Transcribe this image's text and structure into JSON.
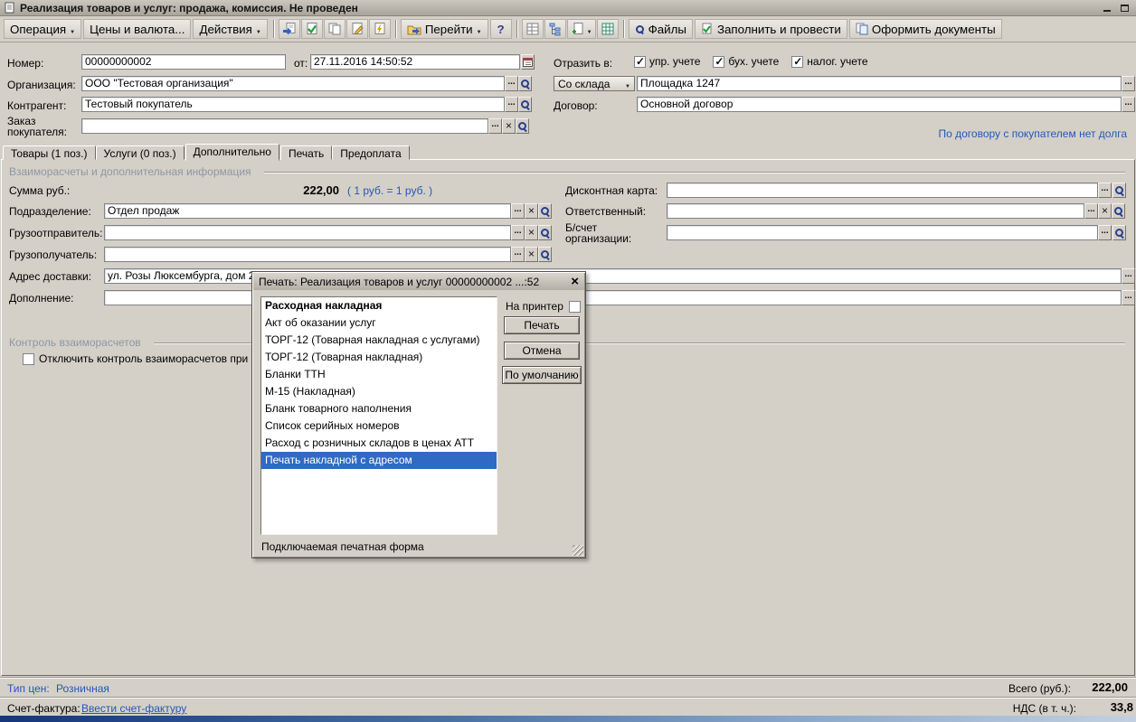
{
  "colors": {
    "link": "#2457b8",
    "selection": "#316ac5",
    "window_bg": "#d4d0c8"
  },
  "window": {
    "title": "Реализация товаров и услуг: продажа, комиссия. Не проведен"
  },
  "toolbar": {
    "operation": "Операция",
    "prices_currency": "Цены и валюта...",
    "actions": "Действия",
    "goto": "Перейти",
    "help": "?",
    "files": "Файлы",
    "fill_and_post": "Заполнить и провести",
    "make_documents": "Оформить документы",
    "icons": [
      "write-document",
      "post-document",
      "copy-document",
      "edit-document",
      "document-lightning",
      "goto-folder",
      "help",
      "subordination-structure",
      "document-movements",
      "input-on-basis",
      "spreadsheet",
      "files-search"
    ]
  },
  "form": {
    "number": {
      "label": "Номер:",
      "value": "00000000002"
    },
    "date": {
      "label": "от:",
      "value": "27.11.2016 14:50:52"
    },
    "reflect": {
      "label": "Отразить в:",
      "options": [
        {
          "label": "упр. учете",
          "checked": true
        },
        {
          "label": "бух. учете",
          "checked": true
        },
        {
          "label": "налог. учете",
          "checked": true
        }
      ]
    },
    "organization": {
      "label": "Организация:",
      "value": "ООО \"Тестовая организация\""
    },
    "warehouse": {
      "label": "Со склада",
      "value": "Площадка 1247"
    },
    "contractor": {
      "label": "Контрагент:",
      "value": "Тестовый покупатель"
    },
    "contract": {
      "label": "Договор:",
      "value": "Основной договор"
    },
    "order": {
      "label_line1": "Заказ",
      "label_line2": "покупателя:",
      "value": ""
    },
    "debt_note": "По договору с покупателем нет долга"
  },
  "tabs": [
    {
      "label": "Товары (1 поз.)"
    },
    {
      "label": "Услуги (0 поз.)"
    },
    {
      "label": "Дополнительно",
      "active": true
    },
    {
      "label": "Печать"
    },
    {
      "label": "Предоплата"
    }
  ],
  "additional": {
    "group_title": "Взаиморасчеты и дополнительная информация",
    "sum": {
      "label": "Сумма руб.:",
      "value": "222,00",
      "rate_note": "( 1 руб. = 1 руб. )"
    },
    "department": {
      "label": "Подразделение:",
      "value": "Отдел продаж"
    },
    "shipper": {
      "label": "Грузоотправитель:",
      "value": ""
    },
    "consignee": {
      "label": "Грузополучатель:",
      "value": ""
    },
    "delivery_address": {
      "label": "Адрес доставки:",
      "value": "ул. Розы Люксембурга, дом 24"
    },
    "addition": {
      "label": "Дополнение:",
      "value": ""
    },
    "discount_card": {
      "label": "Дисконтная карта:",
      "value": ""
    },
    "responsible": {
      "label": "Ответственный:",
      "value": ""
    },
    "bank_account": {
      "label_line1": "Б/счет",
      "label_line2": "организации:",
      "value": ""
    },
    "control_group_title": "Контроль взаиморасчетов",
    "control_checkbox": {
      "label": "Отключить контроль взаиморасчетов при пров",
      "checked": false
    }
  },
  "print_dialog": {
    "title": "Печать: Реализация товаров и услуг 00000000002 ...:52",
    "items": [
      {
        "label": "Расходная накладная",
        "bold": true
      },
      {
        "label": "Акт об оказании услуг"
      },
      {
        "label": "ТОРГ-12 (Товарная накладная с услугами)"
      },
      {
        "label": "ТОРГ-12 (Товарная накладная)"
      },
      {
        "label": "Бланки ТТН"
      },
      {
        "label": "М-15 (Накладная)"
      },
      {
        "label": "Бланк товарного наполнения"
      },
      {
        "label": "Список серийных номеров"
      },
      {
        "label": "Расход с розничных складов в ценах АТТ"
      },
      {
        "label": "Печать накладной с адресом",
        "selected": true
      }
    ],
    "to_printer": {
      "label": "На принтер",
      "checked": false
    },
    "buttons": {
      "print": "Печать",
      "cancel": "Отмена",
      "default_btn": "По умолчанию"
    },
    "footer_note": "Подключаемая печатная форма"
  },
  "footer": {
    "price_type_label": "Тип цен:",
    "price_type_value": "Розничная",
    "invoice_label": "Счет-фактура:",
    "invoice_link": "Ввести счет-фактуру",
    "total_label": "Всего (руб.):",
    "total_value": "222,00",
    "vat_label": "НДС (в т. ч.):",
    "vat_value": "33,8"
  }
}
